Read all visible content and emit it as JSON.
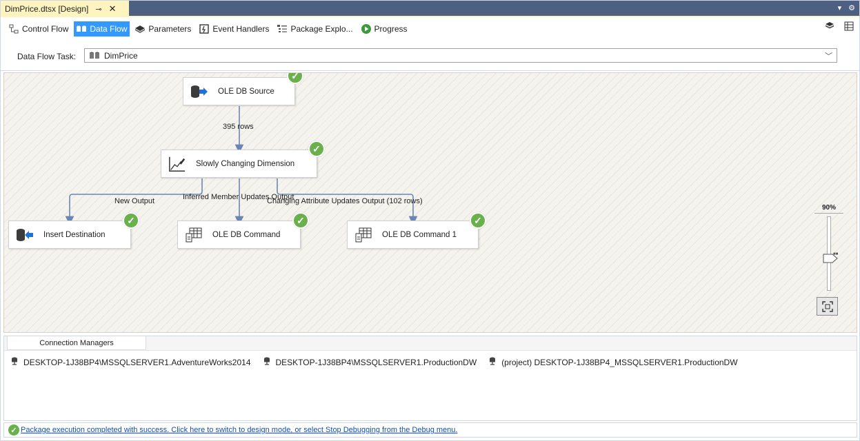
{
  "document_tab": {
    "title": "DimPrice.dtsx [Design]",
    "pin_icon": "pin-icon",
    "close_icon": "close-icon"
  },
  "designer_tabs": [
    {
      "label": "Control Flow",
      "icon": "control-flow-icon",
      "active": false
    },
    {
      "label": "Data Flow",
      "icon": "data-flow-icon",
      "active": true
    },
    {
      "label": "Parameters",
      "icon": "parameters-icon",
      "active": false
    },
    {
      "label": "Event Handlers",
      "icon": "event-handlers-icon",
      "active": false
    },
    {
      "label": "Package Explo...",
      "icon": "package-explorer-icon",
      "active": false
    },
    {
      "label": "Progress",
      "icon": "progress-icon",
      "active": false
    }
  ],
  "task_selector": {
    "label": "Data Flow Task:",
    "value": "DimPrice"
  },
  "components": {
    "source": "OLE DB Source",
    "scd": "Slowly Changing Dimension",
    "insert": "Insert Destination",
    "command": "OLE DB Command",
    "command1": "OLE DB Command 1"
  },
  "paths": {
    "rows": "395 rows",
    "new_output": "New Output",
    "inferred": "Inferred Member Updates Output",
    "changing": "Changing Attribute Updates Output (102 rows)"
  },
  "zoom": {
    "label": "90%",
    "level_percent": 90
  },
  "connections": {
    "tab_label": "Connection Managers",
    "items": [
      "DESKTOP-1J38BP4\\MSSQLSERVER1.AdventureWorks2014",
      "DESKTOP-1J38BP4\\MSSQLSERVER1.ProductionDW",
      "(project) DESKTOP-1J38BP4_MSSQLSERVER1.ProductionDW"
    ]
  },
  "status": {
    "message": "Package execution completed with success. Click here to switch to design mode, or select Stop Debugging from the Debug menu."
  },
  "colors": {
    "accent": "#3399ff",
    "success": "#6ab04c",
    "tab_strip": "#4d6082",
    "active_doc_tab": "#fdf4bf",
    "path_line": "#6a86b6"
  }
}
